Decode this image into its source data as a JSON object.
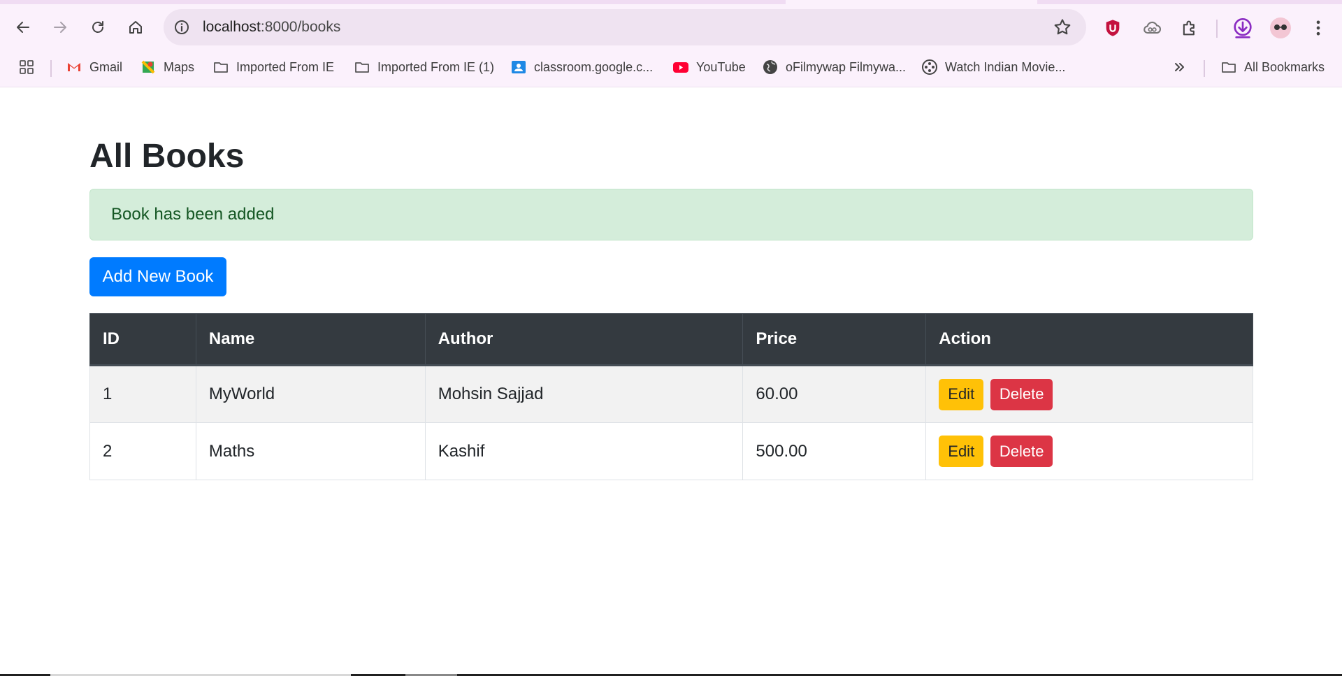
{
  "browser": {
    "url_host": "localhost",
    "url_path": ":8000/books",
    "bookmarks": [
      {
        "label": "Gmail",
        "icon": "gmail-icon"
      },
      {
        "label": "Maps",
        "icon": "maps-icon"
      },
      {
        "label": "Imported From IE",
        "icon": "folder-icon"
      },
      {
        "label": "Imported From IE (1)",
        "icon": "folder-icon"
      },
      {
        "label": "classroom.google.c...",
        "icon": "classroom-icon"
      },
      {
        "label": "YouTube",
        "icon": "youtube-icon"
      },
      {
        "label": "oFilmywap Filmywa...",
        "icon": "globe-icon"
      },
      {
        "label": "Watch Indian Movie...",
        "icon": "film-reel-icon"
      }
    ],
    "all_bookmarks_label": "All Bookmarks"
  },
  "page": {
    "title": "All Books",
    "alert": "Book has been added",
    "add_button": "Add New Book"
  },
  "table": {
    "headers": [
      "ID",
      "Name",
      "Author",
      "Price",
      "Action"
    ],
    "rows": [
      {
        "id": "1",
        "name": "MyWorld",
        "author": "Mohsin Sajjad",
        "price": "60.00"
      },
      {
        "id": "2",
        "name": "Maths",
        "author": "Kashif",
        "price": "500.00"
      }
    ],
    "edit_label": "Edit",
    "delete_label": "Delete"
  },
  "colors": {
    "primary": "#007bff",
    "success_bg": "#d4edda",
    "success_text": "#155724",
    "warning": "#ffc107",
    "danger": "#dc3545",
    "table_header": "#343a40"
  }
}
